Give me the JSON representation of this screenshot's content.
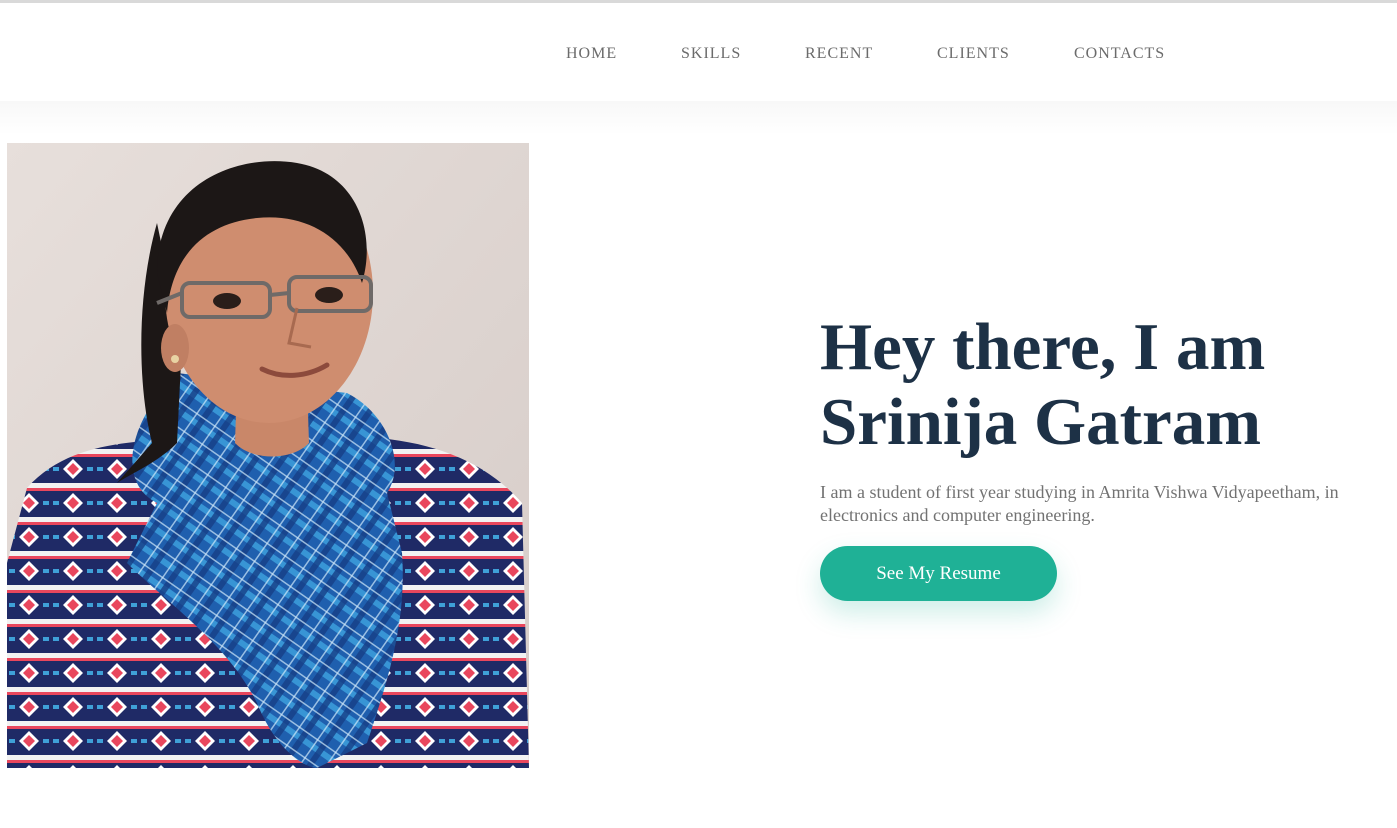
{
  "nav": {
    "items": [
      {
        "label": "HOME"
      },
      {
        "label": "SKILLS"
      },
      {
        "label": "RECENT"
      },
      {
        "label": "CLIENTS"
      },
      {
        "label": "CONTACTS"
      }
    ]
  },
  "hero": {
    "title_line1": "Hey there, I am",
    "title_line2": "Srinija Gatram",
    "description": "I am a student of first year studying in Amrita Vishwa Vidyapeetham, in electronics and computer engineering.",
    "button_label": "See My Resume"
  },
  "colors": {
    "accent": "#1fb196",
    "title": "#1d3146",
    "body_text": "#727272",
    "nav_text": "#6b6b6b"
  }
}
